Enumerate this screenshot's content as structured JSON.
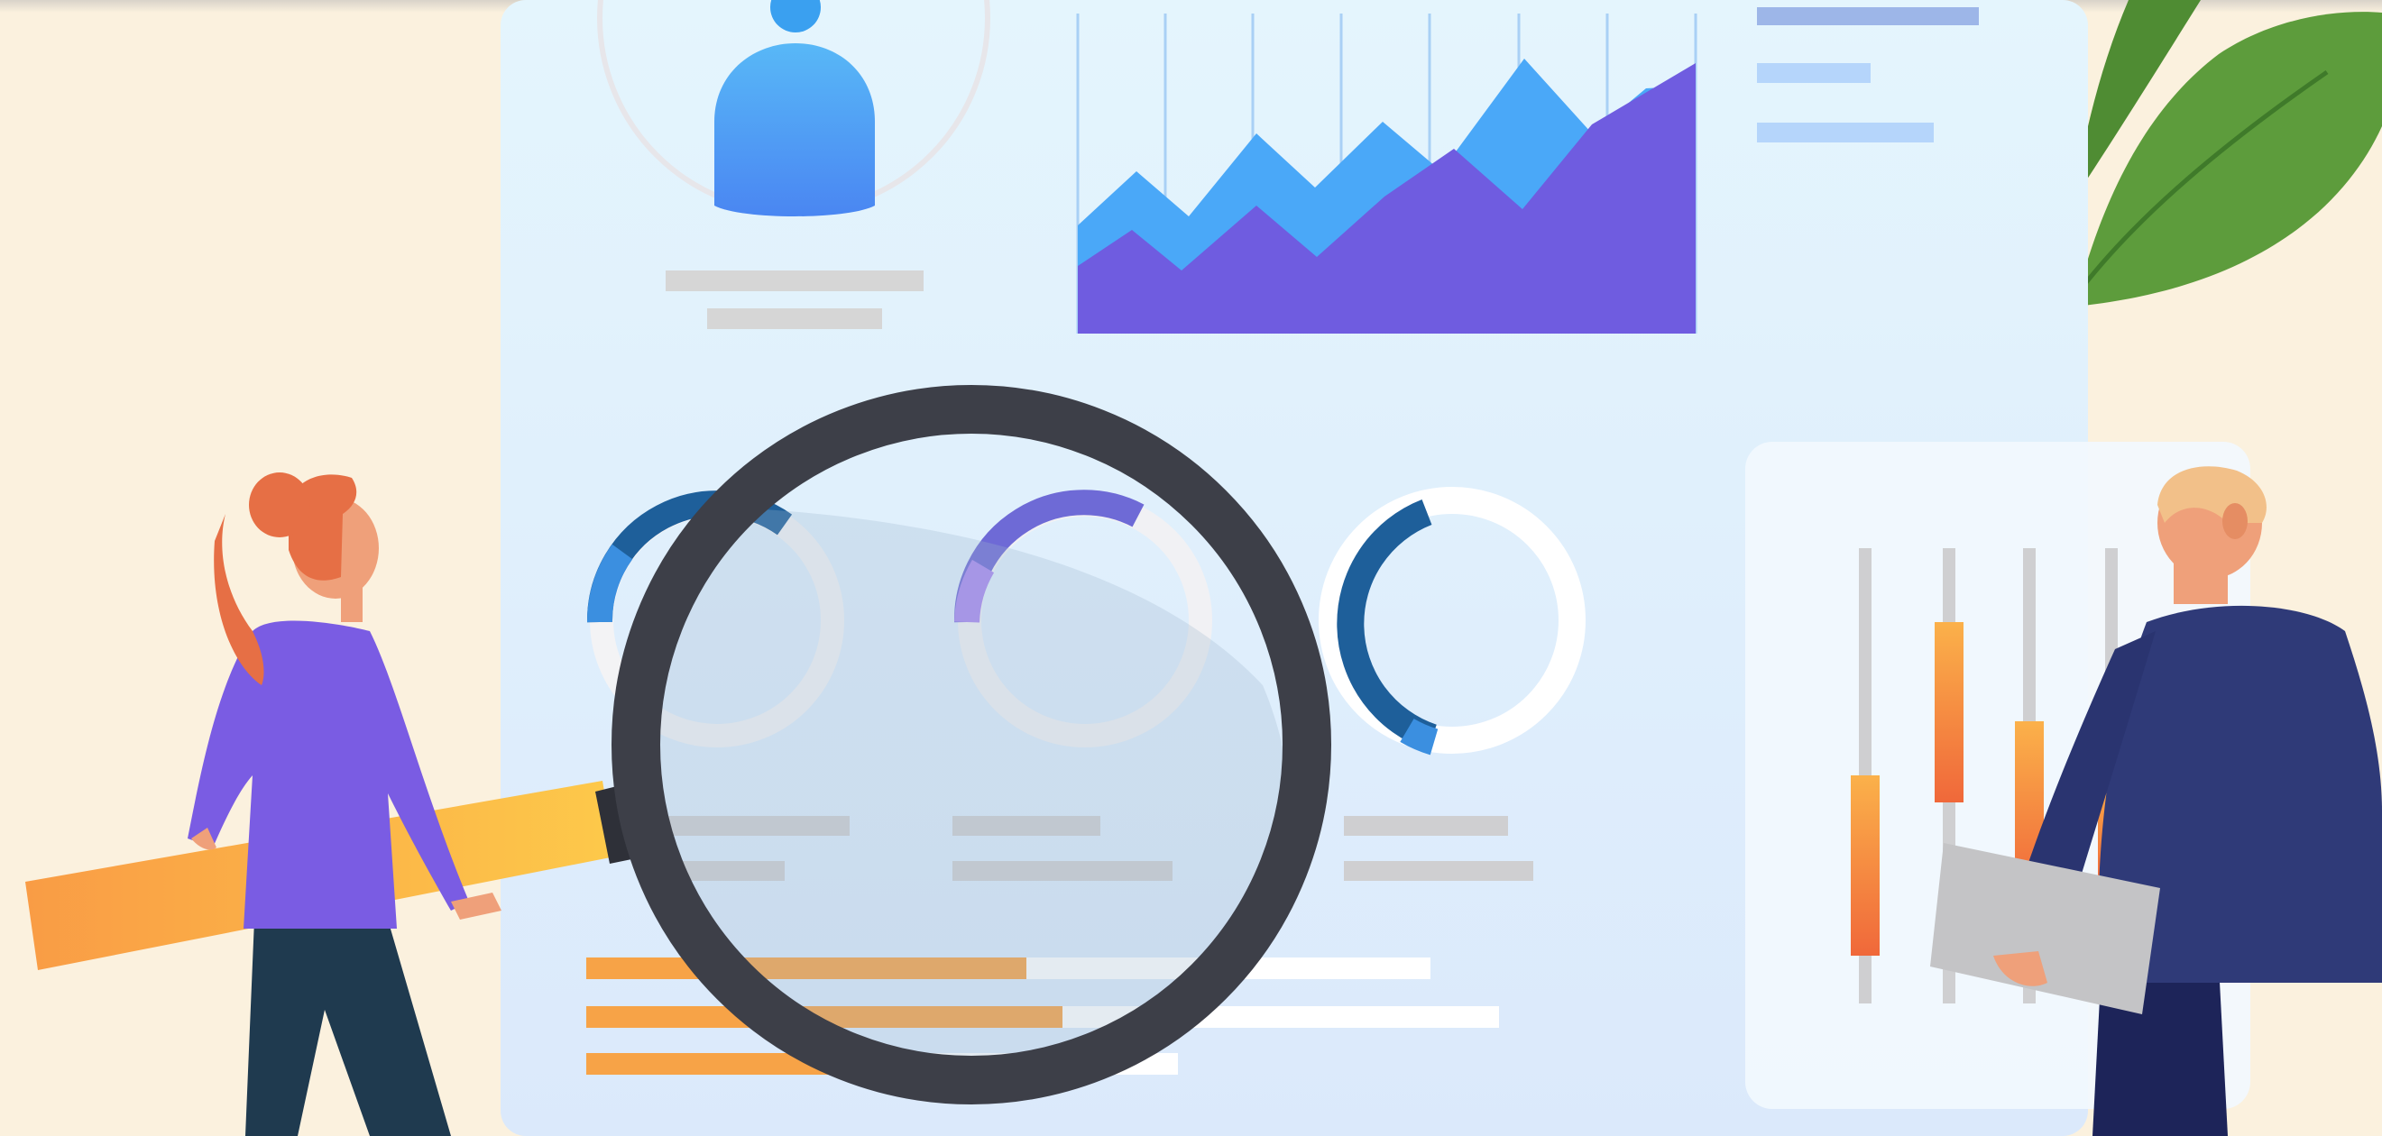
{
  "illustration": {
    "palette": {
      "background": "#fbf1de",
      "dashboard_panel": "#e3f0fb",
      "chart_front": "#6f5ce0",
      "chart_back": "#4aa8f8",
      "donut_dark": "#1e5f9a",
      "donut_light": "#3b8fe0",
      "donut_purple": "#8b6fe8",
      "progress_orange": "#f7a347",
      "slider_orange": "#f07b3f",
      "magnifier_frame": "#3d3f48",
      "leaf_green": "#5d9c3c",
      "woman_shirt": "#7a5ce3",
      "woman_hair": "#e66f45",
      "man_suit": "#2f3a78",
      "man_hair": "#f2c089"
    },
    "icons": [
      "user-avatar-icon",
      "area-chart-icon",
      "donut-chart-icon",
      "magnifying-glass-icon",
      "slider-controls-icon",
      "leaf-icon"
    ]
  }
}
